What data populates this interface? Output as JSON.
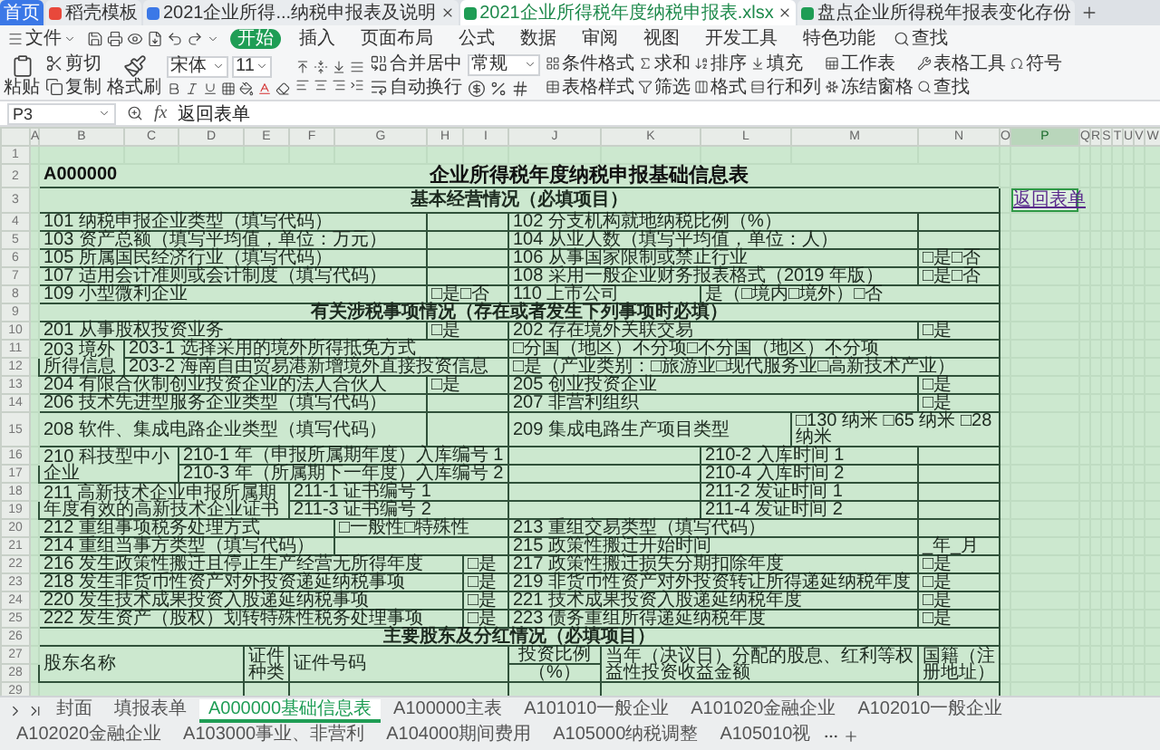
{
  "app_tabs": [
    {
      "label": "首页",
      "kind": "home",
      "selected": false,
      "closable": false
    },
    {
      "label": "稻壳模板",
      "kind": "template",
      "selected": false,
      "closable": false
    },
    {
      "label": "2021企业所得...纳税申报表及说明",
      "kind": "writer",
      "selected": false,
      "closable": true
    },
    {
      "label": "2021企业所得税年度纳税申报表.xlsx",
      "kind": "sheet",
      "selected": true,
      "closable": true
    },
    {
      "label": "盘点企业所得税年报表变化存份",
      "kind": "sheet",
      "selected": false,
      "closable": false
    }
  ],
  "menu": {
    "file": "文件",
    "tabs": [
      {
        "label": "开始",
        "selected": true
      },
      {
        "label": "插入",
        "selected": false
      },
      {
        "label": "页面布局",
        "selected": false
      },
      {
        "label": "公式",
        "selected": false
      },
      {
        "label": "数据",
        "selected": false
      },
      {
        "label": "审阅",
        "selected": false
      },
      {
        "label": "视图",
        "selected": false
      },
      {
        "label": "开发工具",
        "selected": false
      },
      {
        "label": "特色功能",
        "selected": false
      }
    ],
    "search": "查找"
  },
  "ribbon": {
    "paste": "粘贴",
    "cut": "剪切",
    "copy": "复制",
    "format_painter": "格式刷",
    "font": "宋体",
    "font_size": "11",
    "merge": "合并居中",
    "wrap": "自动换行",
    "number_format": "常规",
    "tools": [
      {
        "label": "条件格式",
        "kind": "conditional"
      },
      {
        "label": "表格样式",
        "kind": "table_style"
      },
      {
        "label": "求和",
        "kind": "sum"
      },
      {
        "label": "筛选",
        "kind": "filter"
      },
      {
        "label": "排序",
        "kind": "sort"
      },
      {
        "label": "格式",
        "kind": "format"
      },
      {
        "label": "填充",
        "kind": "fill"
      },
      {
        "label": "行和列",
        "kind": "rows_cols"
      },
      {
        "label": "工作表",
        "kind": "worksheet"
      },
      {
        "label": "冻结窗格",
        "kind": "freeze"
      },
      {
        "label": "表格工具",
        "kind": "table_tools"
      },
      {
        "label": "查找",
        "kind": "find"
      },
      {
        "label": "符号",
        "kind": "symbol"
      }
    ]
  },
  "formula_bar": {
    "cell": "P3",
    "function_label": "fx",
    "formula": "返回表单"
  },
  "columns": [
    {
      "label": "A",
      "selected": false
    },
    {
      "label": "B",
      "selected": false
    },
    {
      "label": "C",
      "selected": false
    },
    {
      "label": "D",
      "selected": false
    },
    {
      "label": "E",
      "selected": false
    },
    {
      "label": "F",
      "selected": false
    },
    {
      "label": "G",
      "selected": false
    },
    {
      "label": "H",
      "selected": false
    },
    {
      "label": "I",
      "selected": false
    },
    {
      "label": "J",
      "selected": false
    },
    {
      "label": "K",
      "selected": false
    },
    {
      "label": "L",
      "selected": false
    },
    {
      "label": "M",
      "selected": false
    },
    {
      "label": "N",
      "selected": false
    },
    {
      "label": "O",
      "selected": false
    },
    {
      "label": "P",
      "selected": true
    },
    {
      "label": "Q",
      "selected": false
    },
    {
      "label": "R",
      "selected": false
    },
    {
      "label": "S",
      "selected": false
    },
    {
      "label": "T",
      "selected": false
    },
    {
      "label": "U",
      "selected": false
    },
    {
      "label": "V",
      "selected": false
    },
    {
      "label": "W",
      "selected": false
    }
  ],
  "sheet": {
    "rows": [
      {
        "number": "1"
      },
      {
        "number": "2",
        "code": "A000000",
        "title": "企业所得税年度纳税申报基础信息表"
      },
      {
        "number": "3",
        "link": "返回表单",
        "cells": [
          {
            "t": "基本经营情况（必填项目）",
            "kind": "section"
          }
        ]
      },
      {
        "number": "4",
        "cells": [
          {
            "t": "101 纳税申报企业类型（填写代码）",
            "kind": "label"
          },
          {
            "kind": "blank"
          },
          {
            "t": "102 分支机构就地纳税比例（%）",
            "kind": "label"
          },
          {
            "kind": "blank"
          }
        ]
      },
      {
        "number": "5",
        "cells": [
          {
            "t": "103 资产总额（填写平均值，单位：万元）",
            "kind": "label"
          },
          {
            "kind": "blank"
          },
          {
            "t": "104 从业人数（填写平均值，单位：人）",
            "kind": "label"
          },
          {
            "kind": "blank"
          }
        ]
      },
      {
        "number": "6",
        "cells": [
          {
            "t": "105 所属国民经济行业（填写代码）",
            "kind": "label"
          },
          {
            "kind": "blank"
          },
          {
            "t": "106 从事国家限制或禁止行业",
            "kind": "label"
          },
          {
            "t": "□是□否",
            "kind": "value"
          }
        ]
      },
      {
        "number": "7",
        "cells": [
          {
            "t": "107 适用会计准则或会计制度（填写代码）",
            "kind": "label"
          },
          {
            "kind": "blank"
          },
          {
            "t": "108 采用一般企业财务报表格式（2019 年版）",
            "kind": "label"
          },
          {
            "t": "□是□否",
            "kind": "value"
          }
        ]
      },
      {
        "number": "8",
        "cells": [
          {
            "t": "109 小型微利企业",
            "kind": "label"
          },
          {
            "t": "□是□否",
            "kind": "value"
          },
          {
            "t": "110 上市公司",
            "kind": "label"
          },
          {
            "t": "是（□境内□境外）□否",
            "kind": "value"
          }
        ]
      },
      {
        "number": "9",
        "cells": [
          {
            "t": "有关涉税事项情况（存在或者发生下列事项时必填）",
            "kind": "section"
          }
        ]
      },
      {
        "number": "10",
        "cells": [
          {
            "t": "201 从事股权投资业务",
            "kind": "label"
          },
          {
            "t": "□是",
            "kind": "value"
          },
          {
            "t": "202 存在境外关联交易",
            "kind": "label"
          },
          {
            "t": "□是",
            "kind": "value"
          }
        ]
      },
      {
        "number": "11",
        "cells": [
          {
            "t": "203 境外所得信息",
            "kind": "label"
          },
          {
            "t": "203-1 选择采用的境外所得抵免方式",
            "kind": "label"
          },
          {
            "t": "□分国（地区）不分项□不分国（地区）不分项",
            "kind": "value"
          }
        ]
      },
      {
        "number": "12",
        "cells": [
          {
            "t": "203-2 海南自由贸易港新增境外直接投资信息",
            "kind": "label"
          },
          {
            "t": "□是（产业类别：□旅游业□现代服务业□高新技术产业）",
            "kind": "value"
          }
        ]
      },
      {
        "number": "13",
        "cells": [
          {
            "t": "204 有限合伙制创业投资企业的法人合伙人",
            "kind": "label"
          },
          {
            "t": "□是",
            "kind": "value"
          },
          {
            "t": "205 创业投资企业",
            "kind": "label"
          },
          {
            "t": "□是",
            "kind": "value"
          }
        ]
      },
      {
        "number": "14",
        "cells": [
          {
            "t": "206 技术先进型服务企业类型（填写代码）",
            "kind": "label"
          },
          {
            "kind": "blank"
          },
          {
            "t": "207 非营利组织",
            "kind": "label"
          },
          {
            "t": "□是",
            "kind": "value"
          }
        ]
      },
      {
        "number": "15",
        "cells": [
          {
            "t": "208 软件、集成电路企业类型（填写代码）",
            "kind": "label"
          },
          {
            "kind": "blank"
          },
          {
            "t": "209 集成电路生产项目类型",
            "kind": "label"
          },
          {
            "t": "□130 纳米 □65 纳米 □28 纳米",
            "kind": "value"
          }
        ]
      },
      {
        "number": "16",
        "cells": [
          {
            "t": "210 科技型中小企业",
            "kind": "label"
          },
          {
            "t": "210-1 年（申报所属期年度）入库编号 1",
            "kind": "label"
          },
          {
            "kind": "blank"
          },
          {
            "t": "210-2 入库时间 1",
            "kind": "label"
          },
          {
            "kind": "blank"
          }
        ]
      },
      {
        "number": "17",
        "cells": [
          {
            "t": "210-3 年（所属期下一年度）入库编号 2",
            "kind": "label"
          },
          {
            "kind": "blank"
          },
          {
            "t": "210-4 入库时间 2",
            "kind": "label"
          },
          {
            "kind": "blank"
          }
        ]
      },
      {
        "number": "18",
        "cells": [
          {
            "t": "211 高新技术企业申报所属期年度有效的高新技术企业证书",
            "kind": "label"
          },
          {
            "t": "211-1 证书编号 1",
            "kind": "label"
          },
          {
            "kind": "blank"
          },
          {
            "t": "211-2 发证时间 1",
            "kind": "label"
          },
          {
            "kind": "blank"
          }
        ]
      },
      {
        "number": "19",
        "cells": [
          {
            "t": "211-3 证书编号 2",
            "kind": "label"
          },
          {
            "kind": "blank"
          },
          {
            "t": "211-4 发证时间 2",
            "kind": "label"
          },
          {
            "kind": "blank"
          }
        ]
      },
      {
        "number": "20",
        "cells": [
          {
            "t": "212 重组事项税务处理方式",
            "kind": "label"
          },
          {
            "t": "□一般性□特殊性",
            "kind": "value"
          },
          {
            "t": "213 重组交易类型（填写代码）",
            "kind": "label"
          },
          {
            "kind": "blank"
          }
        ]
      },
      {
        "number": "21",
        "cells": [
          {
            "t": "214 重组当事方类型（填写代码）",
            "kind": "label"
          },
          {
            "kind": "blank"
          },
          {
            "t": "215 政策性搬迁开始时间",
            "kind": "label"
          },
          {
            "t": "_年_月",
            "kind": "value"
          }
        ]
      },
      {
        "number": "22",
        "cells": [
          {
            "t": "216 发生政策性搬迁且停止生产经营无所得年度",
            "kind": "label"
          },
          {
            "t": "□是",
            "kind": "value"
          },
          {
            "t": "217 政策性搬迁损失分期扣除年度",
            "kind": "label"
          },
          {
            "t": "□是",
            "kind": "value"
          }
        ]
      },
      {
        "number": "23",
        "cells": [
          {
            "t": "218 发生非货币性资产对外投资递延纳税事项",
            "kind": "label"
          },
          {
            "t": "□是",
            "kind": "value"
          },
          {
            "t": "219 非货币性资产对外投资转让所得递延纳税年度",
            "kind": "label"
          },
          {
            "t": "□是",
            "kind": "value"
          }
        ]
      },
      {
        "number": "24",
        "cells": [
          {
            "t": "220 发生技术成果投资入股递延纳税事项",
            "kind": "label"
          },
          {
            "t": "□是",
            "kind": "value"
          },
          {
            "t": "221 技术成果投资入股递延纳税年度",
            "kind": "label"
          },
          {
            "t": "□是",
            "kind": "value"
          }
        ]
      },
      {
        "number": "25",
        "cells": [
          {
            "t": "222 发生资产（股权）划转特殊性税务处理事项",
            "kind": "label"
          },
          {
            "t": "□是",
            "kind": "value"
          },
          {
            "t": "223 债务重组所得递延纳税年度",
            "kind": "label"
          },
          {
            "t": "□是",
            "kind": "value"
          }
        ]
      },
      {
        "number": "26",
        "cells": [
          {
            "t": "主要股东及分红情况（必填项目）",
            "kind": "section"
          }
        ]
      },
      {
        "number": "27",
        "cells": [
          {
            "t": "股东名称",
            "kind": "label"
          },
          {
            "t": "证件种类",
            "kind": "head"
          },
          {
            "t": "证件号码",
            "kind": "label"
          },
          {
            "t": "投资比例",
            "kind": "head"
          },
          {
            "t": "当年（决议日）分配的股息、红利等权益性投资收益金额",
            "kind": "label"
          },
          {
            "t": "国籍（注册地址）",
            "kind": "label"
          }
        ]
      },
      {
        "number": "28",
        "cells": [
          {
            "t": "（%）",
            "kind": "head"
          }
        ]
      },
      {
        "number": "29",
        "cells": [
          {
            "kind": "blank"
          },
          {
            "kind": "blank"
          },
          {
            "kind": "blank"
          },
          {
            "kind": "blank"
          },
          {
            "kind": "blank"
          },
          {
            "kind": "blank"
          }
        ]
      }
    ]
  },
  "sheet_tabs": [
    {
      "label": "封面",
      "selected": false
    },
    {
      "label": "填报表单",
      "selected": false
    },
    {
      "label": "A000000基础信息表",
      "selected": true
    },
    {
      "label": "A100000主表",
      "selected": false
    },
    {
      "label": "A101010一般企业",
      "selected": false
    },
    {
      "label": "A101020金融企业",
      "selected": false
    },
    {
      "label": "A102010一般企业",
      "selected": false
    },
    {
      "label": "A102020金融企业",
      "selected": false
    },
    {
      "label": "A103000事业、非营利",
      "selected": false
    },
    {
      "label": "A104000期间费用",
      "selected": false
    },
    {
      "label": "A105000纳税调整",
      "selected": false
    },
    {
      "label": "A105010视",
      "selected": false
    }
  ]
}
